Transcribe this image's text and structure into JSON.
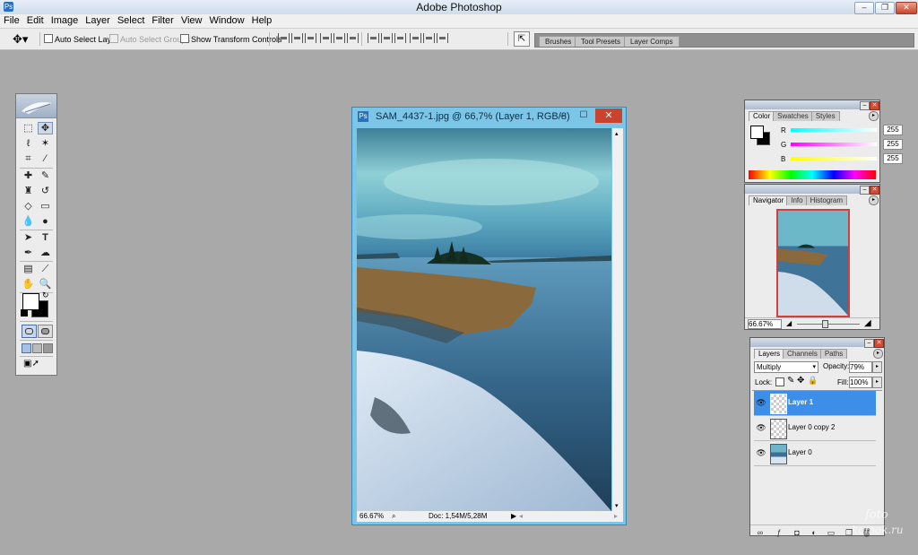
{
  "app": {
    "title": "Adobe Photoshop",
    "icon": "photoshop-app-icon"
  },
  "menu": [
    "File",
    "Edit",
    "Image",
    "Layer",
    "Select",
    "Filter",
    "View",
    "Window",
    "Help"
  ],
  "options": {
    "auto_select_layer": "Auto Select Layer",
    "auto_select_groups": "Auto Select Groups",
    "show_transform_controls": "Show Transform Controls",
    "auto_select_layer_checked": false,
    "auto_select_groups_checked": true,
    "show_transform_controls_checked": false
  },
  "palette_well": {
    "tabs": [
      "Brushes",
      "Tool Presets",
      "Layer Comps"
    ]
  },
  "toolbox": {
    "tools": [
      "marquee-tool",
      "move-tool",
      "lasso-tool",
      "magic-wand-tool",
      "crop-tool",
      "slice-tool",
      "healing-brush-tool",
      "brush-tool",
      "clone-stamp-tool",
      "history-brush-tool",
      "eraser-tool",
      "gradient-tool",
      "blur-tool",
      "dodge-tool",
      "path-selection-tool",
      "type-tool",
      "pen-tool",
      "custom-shape-tool",
      "notes-tool",
      "eyedropper-tool",
      "hand-tool",
      "zoom-tool"
    ],
    "foreground_color": "#ffffff",
    "background_color": "#000000"
  },
  "document": {
    "title": "SAM_4437-1.jpg @ 66,7% (Layer 1, RGB/8)",
    "zoom": "66.67%",
    "doc_info": "Doc: 1,54M/5,28M",
    "minimize": "–",
    "maximize": "☐",
    "close": "✕"
  },
  "color_panel": {
    "tabs": [
      "Color",
      "Swatches",
      "Styles"
    ],
    "active_tab": "Color",
    "channels": [
      {
        "label": "R",
        "value": "255"
      },
      {
        "label": "G",
        "value": "255"
      },
      {
        "label": "B",
        "value": "255"
      }
    ]
  },
  "navigator_panel": {
    "tabs": [
      "Navigator",
      "Info",
      "Histogram"
    ],
    "active_tab": "Navigator",
    "zoom": "66.67%"
  },
  "layers_panel": {
    "tabs": [
      "Layers",
      "Channels",
      "Paths"
    ],
    "active_tab": "Layers",
    "blend_mode": "Multiply",
    "opacity_label": "Opacity:",
    "opacity": "79%",
    "lock_label": "Lock:",
    "fill_label": "Fill:",
    "fill": "100%",
    "layers": [
      {
        "name": "Layer 1",
        "selected": true,
        "thumb": "transparent"
      },
      {
        "name": "Layer 0 copy 2",
        "selected": false,
        "thumb": "transparent"
      },
      {
        "name": "Layer 0",
        "selected": false,
        "thumb": "photo"
      }
    ]
  },
  "watermark": {
    "line1": "foto",
    "line2": "komok.ru"
  },
  "colors": {
    "selected_layer": "#3d8ee8",
    "doc_frame": "#7bc5e7",
    "close_button": "#d14c36"
  }
}
